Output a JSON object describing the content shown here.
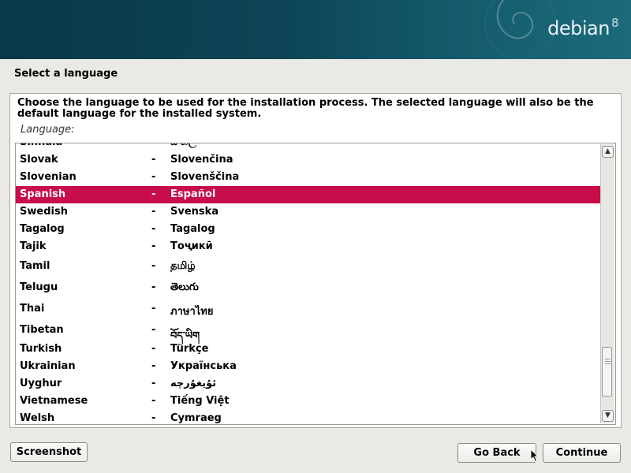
{
  "header": {
    "logo_text": "debian",
    "logo_version": "8"
  },
  "page": {
    "title": "Select a language",
    "description": "Choose the language to be used for the installation process. The selected language will also be the default language for the installed system.",
    "list_label": "Language:"
  },
  "languages": [
    {
      "name": "Sinhala",
      "native": "සිංහල"
    },
    {
      "name": "Slovak",
      "native": "Slovenčina"
    },
    {
      "name": "Slovenian",
      "native": "Slovenščina"
    },
    {
      "name": "Spanish",
      "native": "Español"
    },
    {
      "name": "Swedish",
      "native": "Svenska"
    },
    {
      "name": "Tagalog",
      "native": "Tagalog"
    },
    {
      "name": "Tajik",
      "native": "Тоҷикӣ"
    },
    {
      "name": "Tamil",
      "native": "தமிழ்"
    },
    {
      "name": "Telugu",
      "native": "తెలుగు"
    },
    {
      "name": "Thai",
      "native": "ภาษาไทย"
    },
    {
      "name": "Tibetan",
      "native": "བོད་ཡིག"
    },
    {
      "name": "Turkish",
      "native": "Türkçe"
    },
    {
      "name": "Ukrainian",
      "native": "Українська"
    },
    {
      "name": "Uyghur",
      "native": "ئۇيغۇرچە"
    },
    {
      "name": "Vietnamese",
      "native": "Tiếng Việt"
    },
    {
      "name": "Welsh",
      "native": "Cymraeg"
    }
  ],
  "separator": "-",
  "selected_language": "Spanish",
  "scrollbar": {
    "position_fraction": 0.95,
    "visible_fraction": 0.2
  },
  "buttons": {
    "screenshot": "Screenshot",
    "go_back": "Go Back",
    "continue": "Continue"
  },
  "colors": {
    "selection": "#c70d4a",
    "banner": "#0d4556"
  }
}
